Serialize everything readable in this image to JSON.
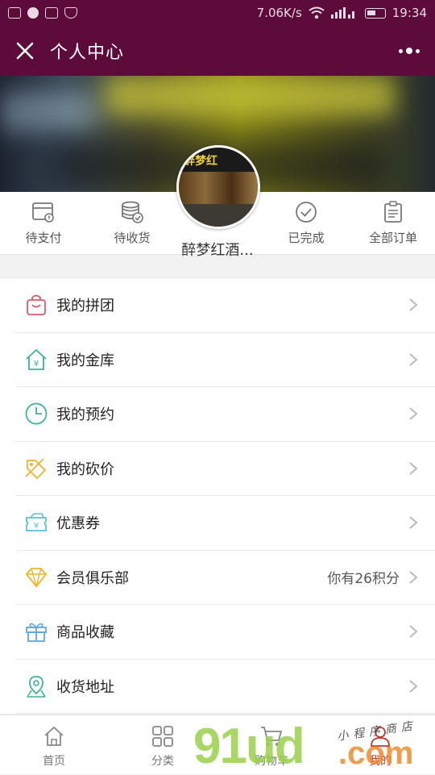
{
  "status_bar": {
    "speed": "7.06K/s",
    "time": "19:34"
  },
  "header": {
    "title": "个人中心"
  },
  "profile": {
    "store_sign": "醉梦红",
    "username": "醉梦红酒..."
  },
  "orders": [
    {
      "label": "待支付",
      "icon": "wallet-icon"
    },
    {
      "label": "待收货",
      "icon": "coin-stack-icon"
    },
    {
      "label": "已完成",
      "icon": "check-circle-icon"
    },
    {
      "label": "全部订单",
      "icon": "clipboard-icon"
    }
  ],
  "menu": [
    {
      "label": "我的拼团",
      "icon": "shopping-bag-icon",
      "color": "#e05a6a"
    },
    {
      "label": "我的金库",
      "icon": "house-yen-icon",
      "color": "#3ab59a"
    },
    {
      "label": "我的预约",
      "icon": "clock-icon",
      "color": "#3ab59a"
    },
    {
      "label": "我的砍价",
      "icon": "price-tag-icon",
      "color": "#f0b429"
    },
    {
      "label": "优惠券",
      "icon": "coupon-icon",
      "color": "#5bc0de"
    },
    {
      "label": "会员俱乐部",
      "icon": "diamond-icon",
      "color": "#f0b429",
      "value": "你有26积分"
    },
    {
      "label": "商品收藏",
      "icon": "gift-icon",
      "color": "#5aa9e6"
    },
    {
      "label": "收货地址",
      "icon": "map-pin-icon",
      "color": "#3ab59a"
    }
  ],
  "tabbar": [
    {
      "label": "首页",
      "icon": "home-icon"
    },
    {
      "label": "分类",
      "icon": "grid-icon"
    },
    {
      "label": "购物车",
      "icon": "cart-icon"
    },
    {
      "label": "我的",
      "icon": "user-icon"
    }
  ],
  "watermark": {
    "main": "91ud",
    "suffix": ".com",
    "tagline": "小程序商店"
  },
  "colors": {
    "header_bg": "#5d0b3a",
    "accent": "#f08a2a"
  }
}
